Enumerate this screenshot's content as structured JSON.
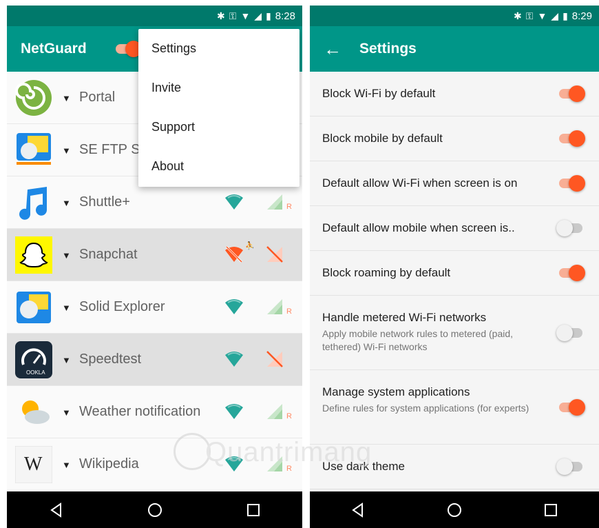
{
  "left": {
    "status": {
      "time": "8:28"
    },
    "appbar": {
      "title": "NetGuard",
      "toggle_on": true
    },
    "menu": {
      "items": [
        "Settings",
        "Invite",
        "Support",
        "About"
      ]
    },
    "apps": [
      {
        "name": "Portal",
        "icon": "portal-icon",
        "highlighted": false
      },
      {
        "name": "SE FTP S",
        "icon": "se-ftp-icon",
        "highlighted": false
      },
      {
        "name": "Shuttle+",
        "icon": "shuttle-icon",
        "highlighted": false,
        "wifi": "allowed",
        "cell": "allowed-roaming",
        "roaming_label": "R"
      },
      {
        "name": "Snapchat",
        "icon": "snapchat-icon",
        "highlighted": true,
        "wifi": "blocked",
        "cell": "blocked"
      },
      {
        "name": "Solid Explorer",
        "icon": "solid-explorer-icon",
        "highlighted": false,
        "wifi": "allowed",
        "cell": "allowed-roaming",
        "roaming_label": "R"
      },
      {
        "name": "Speedtest",
        "icon": "speedtest-icon",
        "highlighted": true,
        "wifi": "allowed",
        "cell": "blocked"
      },
      {
        "name": "Weather notification",
        "icon": "weather-icon",
        "highlighted": false,
        "wifi": "allowed",
        "cell": "allowed-roaming",
        "roaming_label": "R"
      },
      {
        "name": "Wikipedia",
        "icon": "wikipedia-icon",
        "highlighted": false,
        "wifi": "allowed",
        "cell": "allowed-roaming",
        "roaming_label": "R"
      }
    ],
    "wiki_glyph": "W"
  },
  "right": {
    "status": {
      "time": "8:29"
    },
    "appbar": {
      "title": "Settings"
    },
    "settings": [
      {
        "title": "Block Wi-Fi by default",
        "summary": "",
        "on": true
      },
      {
        "title": "Block mobile by default",
        "summary": "",
        "on": true
      },
      {
        "title": "Default allow Wi-Fi when screen is on",
        "summary": "",
        "on": true
      },
      {
        "title": "Default allow mobile when screen is..",
        "summary": "",
        "on": false
      },
      {
        "title": "Block roaming by default",
        "summary": "",
        "on": true
      },
      {
        "title": "Handle metered Wi-Fi networks",
        "summary": "Apply mobile network rules to metered (paid, tethered) Wi-Fi networks",
        "on": false
      },
      {
        "title": "Manage system applications",
        "summary": "Define rules for system applications (for experts)",
        "on": true
      },
      {
        "title": "Use dark theme",
        "summary": "",
        "on": false
      }
    ]
  },
  "watermark": {
    "text": "Quantrimang"
  },
  "colors": {
    "statusbar": "#00796b",
    "appbar": "#009688",
    "accent": "#ff5722",
    "wifi": "#26a69a",
    "blocked": "#ff5722"
  }
}
